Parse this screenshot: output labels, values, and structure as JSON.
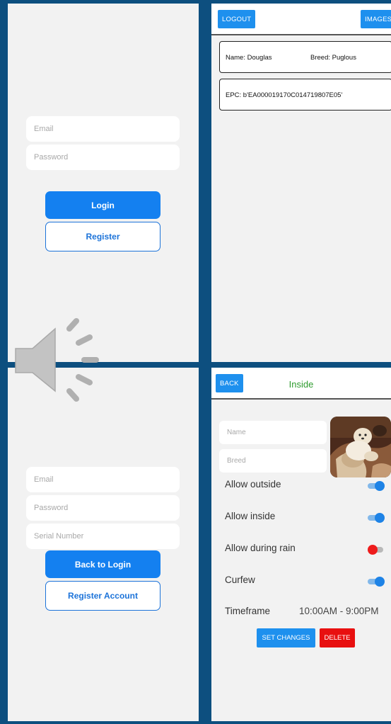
{
  "colors": {
    "background": "#0d4f7f",
    "panel": "#f2f2f2",
    "primary": "#1480f0",
    "toggle_on": "#1e83e6",
    "toggle_off_knob": "#ee1c1c",
    "delete": "#e81010",
    "inside_title": "#2e9b2e"
  },
  "login": {
    "email_placeholder": "Email",
    "password_placeholder": "Password",
    "login_label": "Login",
    "register_label": "Register"
  },
  "dog": {
    "logout_label": "LOGOUT",
    "images_label": "IMAGES",
    "name": "Name: Douglas",
    "breed": "Breed: Puglous",
    "epc": "EPC: b'EA000019170C014719807E05'"
  },
  "register": {
    "email_placeholder": "Email",
    "password_placeholder": "Password",
    "serial_placeholder": "Serial Number",
    "back_label": "Back to Login",
    "register_account_label": "Register Account"
  },
  "settings": {
    "back_label": "BACK",
    "title": "Inside",
    "name_placeholder": "Name",
    "breed_placeholder": "Breed",
    "photo_icon": "dog-photo",
    "allow_outside": {
      "label": "Allow outside",
      "on": true
    },
    "allow_inside": {
      "label": "Allow inside",
      "on": true
    },
    "allow_rain": {
      "label": "Allow during rain",
      "on": false
    },
    "curfew": {
      "label": "Curfew",
      "on": true
    },
    "timeframe_label": "Timeframe",
    "timeframe_value": "10:00AM - 9:00PM",
    "set_changes_label": "SET CHANGES",
    "delete_label": "DELETE"
  },
  "overlay": {
    "icon": "speaker-volume-icon"
  }
}
